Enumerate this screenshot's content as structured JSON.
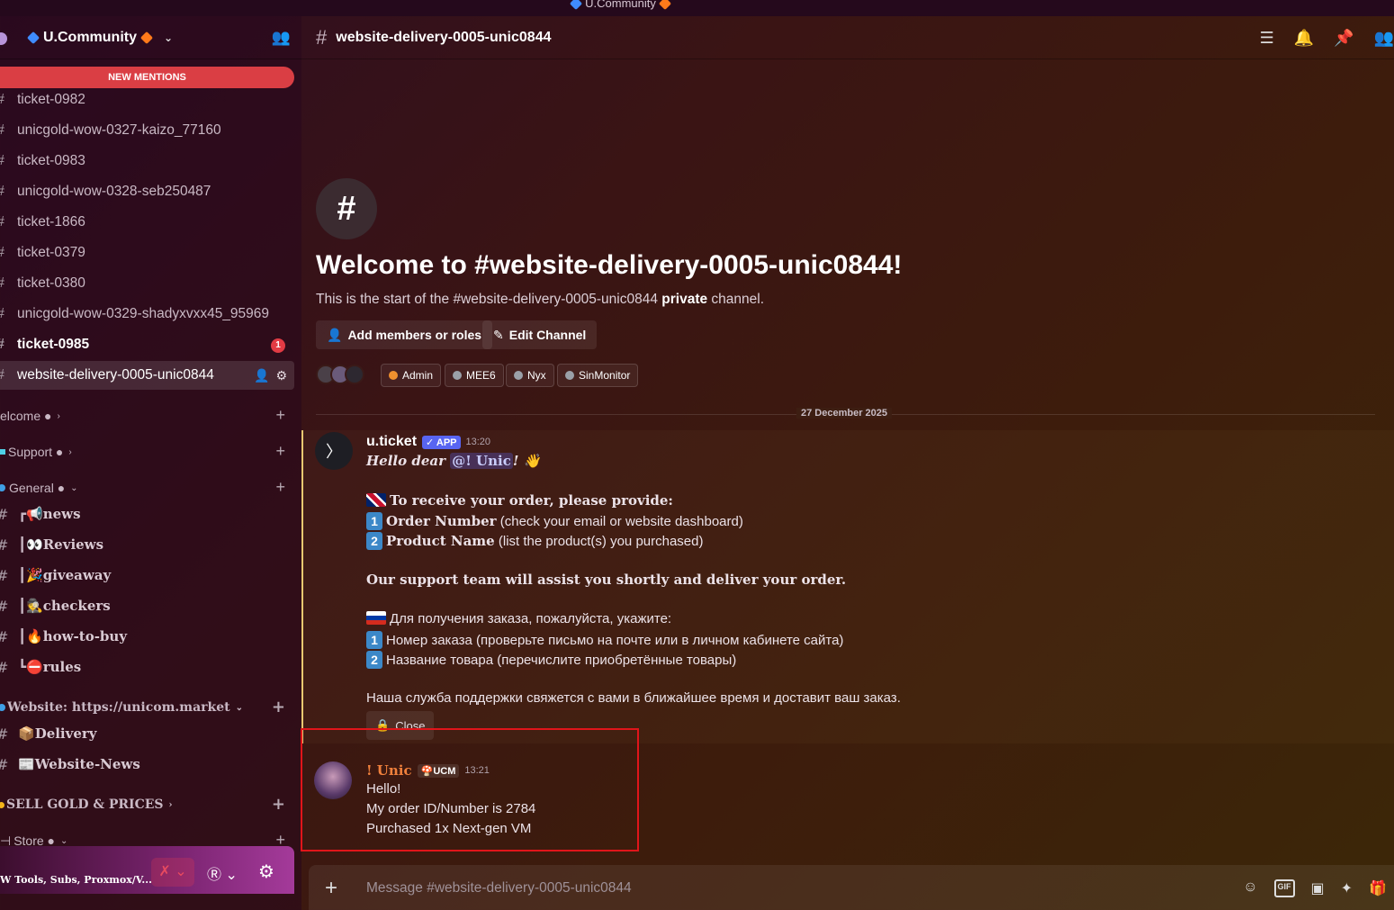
{
  "titlebar": {
    "server_name": "U.Community"
  },
  "server": {
    "name": "U.Community"
  },
  "sidebar": {
    "new_mentions": "NEW MENTIONS",
    "channels": [
      {
        "label": "ticket-0982"
      },
      {
        "label": "unicgold-wow-0327-kaizo_77160"
      },
      {
        "label": "ticket-0983"
      },
      {
        "label": "unicgold-wow-0328-seb250487"
      },
      {
        "label": "ticket-1866"
      },
      {
        "label": "ticket-0379"
      },
      {
        "label": "ticket-0380"
      },
      {
        "label": "unicgold-wow-0329-shadyxvxx45_95969"
      },
      {
        "label": "ticket-0985",
        "badge": "1"
      },
      {
        "label": "website-delivery-0005-unic0844"
      }
    ],
    "categories": {
      "welcome": "elcome ●",
      "support": "Support ●",
      "general": "General ●",
      "website": "Website: https://unicom.market",
      "sell_gold": "SELL GOLD & PRICES",
      "store": "Store ●"
    },
    "general_channels": [
      "news",
      "Reviews",
      "giveaway",
      "checkers",
      "how-to-buy",
      "rules"
    ],
    "website_channels": [
      "Delivery",
      "Website-News"
    ]
  },
  "user_panel": {
    "name": "W Tools, Subs, Proxmox/V..."
  },
  "chat": {
    "channel_title": "website-delivery-0005-unic0844",
    "welcome_title": "Welcome to #website-delivery-0005-unic0844!",
    "welcome_sub_pre": "This is the start of the #website-delivery-0005-unic0844 ",
    "welcome_sub_bold": "private",
    "welcome_sub_post": " channel.",
    "add_members": "Add members or roles",
    "edit_channel": "Edit Channel",
    "roles": [
      {
        "name": "Admin",
        "color": "#f0902e"
      },
      {
        "name": "MEE6",
        "color": "#9aa0a8"
      },
      {
        "name": "Nyx",
        "color": "#9aa0a8"
      },
      {
        "name": "SinMonitor",
        "color": "#9aa0a8"
      }
    ],
    "date_divider": "27 December 2025",
    "composer_placeholder": "Message #website-delivery-0005-unic0844"
  },
  "messages": [
    {
      "author": "u.ticket",
      "tag": "✓ APP",
      "time": "13:20",
      "greeting": "Hello dear ",
      "mention": "@! Unic",
      "greeting_end": "!",
      "en_header": "To receive your order, please provide:",
      "en_1_bold": "Order Number",
      "en_1_rest": " (check your email or website dashboard)",
      "en_2_bold": "Product Name",
      "en_2_rest": " (list the product(s) you purchased)",
      "en_footer": "Our support team will assist you shortly and deliver your order.",
      "ru_header": "Для получения заказа, пожалуйста, укажите:",
      "ru_1": "Номер заказа (проверьте письмо на почте или в личном кабинете сайта)",
      "ru_2": "Название товара (перечислите приобретённые товары)",
      "ru_footer": "Наша служба поддержки свяжется с вами в ближайшее время и доставит ваш заказ.",
      "button": "Close",
      "num1": "1",
      "num2": "2"
    },
    {
      "author": "! Unic",
      "tag": "UCM",
      "time": "13:21",
      "lines": [
        "Hello!",
        "My order ID/Number is 2784",
        "Purchased 1x Next-gen VM"
      ]
    }
  ]
}
